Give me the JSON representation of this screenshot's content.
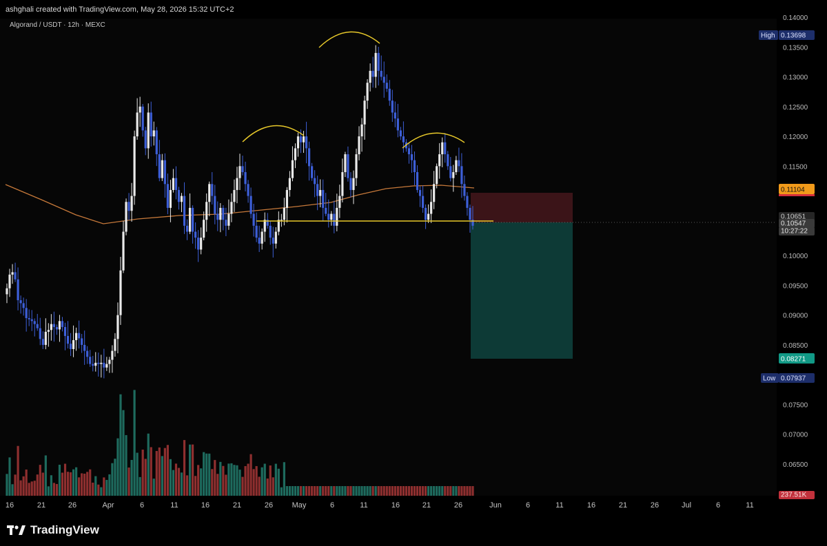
{
  "header": {
    "credit": "ashghali created with TradingView.com, May 28, 2026 15:32 UTC+2"
  },
  "symbol": {
    "label": "Algorand / USDT · 12h · MEXC"
  },
  "brand": {
    "name": "TradingView"
  },
  "colors": {
    "up": "#e9e9e9",
    "down": "#3d5fd8",
    "ma": "#c7793a",
    "neckline": "#e8c92a",
    "stop_zone": "#3b1418",
    "target_zone": "#0d3a36",
    "vol_up": "#1e6b5e",
    "vol_down": "#8e2f2f"
  },
  "chart_data": {
    "type": "candlestick",
    "ylim": [
      0.063,
      0.14
    ],
    "y_ticks": [
      "0.14000",
      "0.13500",
      "0.13000",
      "0.12500",
      "0.12000",
      "0.11500",
      "0.10000",
      "0.09500",
      "0.09000",
      "0.08500",
      "0.07500",
      "0.07000",
      "0.06500"
    ],
    "x_ticks": [
      "16",
      "21",
      "26",
      "Apr",
      "6",
      "11",
      "16",
      "21",
      "26",
      "May",
      "6",
      "11",
      "16",
      "21",
      "26",
      "Jun",
      "6",
      "11",
      "16",
      "21",
      "26",
      "Jul",
      "6",
      "11"
    ],
    "price_labels": {
      "high": {
        "label": "High",
        "value": "0.13698"
      },
      "low": {
        "label": "Low",
        "value": "0.07937"
      },
      "stop": {
        "value": "0.11104"
      },
      "last": {
        "value": "0.10651"
      },
      "current": {
        "value": "0.10547"
      },
      "countdown": {
        "value": "10:27:22"
      },
      "target": {
        "value": "0.08271"
      },
      "volume": {
        "value": "237.51K"
      }
    },
    "closes": [
      0.0945,
      0.0968,
      0.0972,
      0.096,
      0.0925,
      0.092,
      0.0912,
      0.0895,
      0.0893,
      0.089,
      0.0885,
      0.0878,
      0.086,
      0.085,
      0.0872,
      0.0875,
      0.0885,
      0.088,
      0.0876,
      0.089,
      0.088,
      0.0865,
      0.0852,
      0.0843,
      0.0858,
      0.087,
      0.0861,
      0.085,
      0.084,
      0.083,
      0.0818,
      0.0815,
      0.082,
      0.0818,
      0.082,
      0.0812,
      0.0818,
      0.0825,
      0.084,
      0.086,
      0.09,
      0.0975,
      0.104,
      0.109,
      0.1075,
      0.11,
      0.12,
      0.124,
      0.125,
      0.121,
      0.118,
      0.124,
      0.12,
      0.121,
      0.117,
      0.113,
      0.116,
      0.112,
      0.108,
      0.111,
      0.113,
      0.111,
      0.109,
      0.11,
      0.105,
      0.104,
      0.108,
      0.104,
      0.103,
      0.101,
      0.103,
      0.106,
      0.109,
      0.112,
      0.11,
      0.107,
      0.106,
      0.108,
      0.106,
      0.105,
      0.107,
      0.109,
      0.111,
      0.113,
      0.115,
      0.114,
      0.112,
      0.11,
      0.107,
      0.105,
      0.103,
      0.102,
      0.104,
      0.106,
      0.105,
      0.103,
      0.102,
      0.104,
      0.106,
      0.106,
      0.108,
      0.111,
      0.113,
      0.116,
      0.118,
      0.12,
      0.119,
      0.12,
      0.118,
      0.115,
      0.113,
      0.112,
      0.11,
      0.111,
      0.108,
      0.107,
      0.106,
      0.107,
      0.105,
      0.108,
      0.11,
      0.114,
      0.117,
      0.113,
      0.111,
      0.113,
      0.117,
      0.12,
      0.122,
      0.126,
      0.129,
      0.131,
      0.13,
      0.134,
      0.131,
      0.13,
      0.129,
      0.128,
      0.126,
      0.124,
      0.123,
      0.121,
      0.12,
      0.119,
      0.118,
      0.117,
      0.116,
      0.114,
      0.111,
      0.11,
      0.108,
      0.106,
      0.107,
      0.109,
      0.112,
      0.115,
      0.117,
      0.119,
      0.117,
      0.115,
      0.113,
      0.114,
      0.116,
      0.115,
      0.112,
      0.11,
      0.108,
      0.106,
      0.105
    ]
  }
}
